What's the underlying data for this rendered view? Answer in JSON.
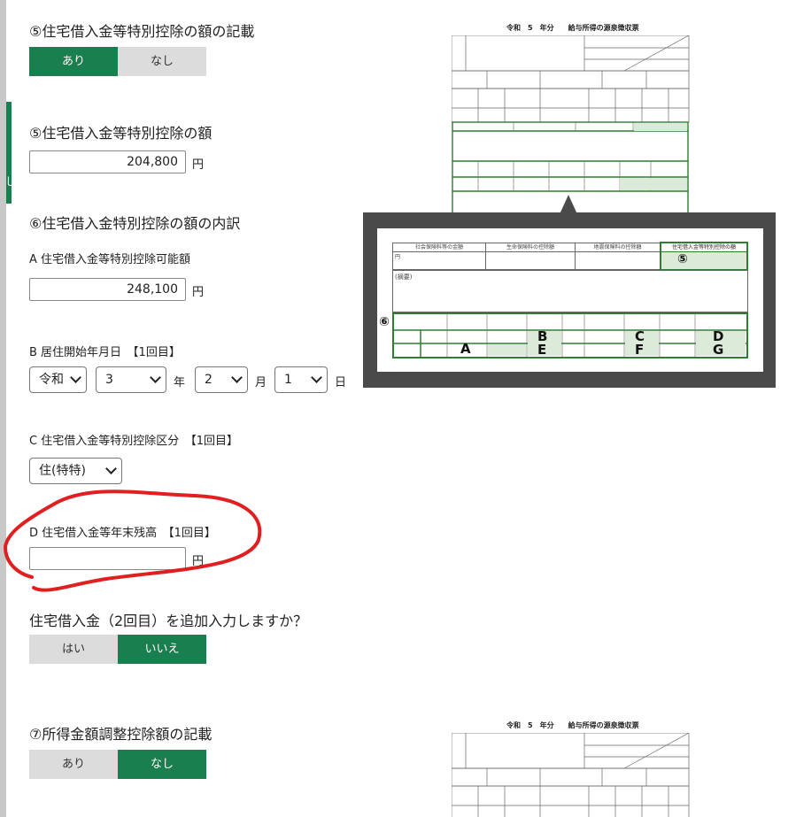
{
  "sidebar": {
    "accent_char": "し"
  },
  "section_5_flag": {
    "title": "⑤住宅借入金等特別控除の額の記載",
    "option_yes": "あり",
    "option_no": "なし",
    "selected": "あり"
  },
  "section_5_amount": {
    "title": "⑤住宅借入金等特別控除の額",
    "value": "204,800",
    "unit": "円"
  },
  "section_6": {
    "title": "⑥住宅借入金特別控除の額の内訳",
    "a_label": "A 住宅借入金等特別控除可能額",
    "a_value": "248,100",
    "a_unit": "円",
    "b_label": "B 居住開始年月日　【1回目】",
    "era": "令和",
    "year": "3",
    "year_unit": "年",
    "month": "2",
    "month_unit": "月",
    "day": "1",
    "day_unit": "日",
    "c_label": "C 住宅借入金等特別控除区分　【1回目】",
    "c_value": "住(特特)",
    "d_label": "D 住宅借入金等年末残高　【1回目】",
    "d_value": "",
    "d_unit": "円"
  },
  "second_loan": {
    "title": "住宅借入金（2回目）を追加入力しますか？",
    "option_yes": "はい",
    "option_no": "いいえ",
    "selected": "いいえ"
  },
  "section_7": {
    "title": "⑦所得金額調整控除額の記載",
    "option_yes": "あり",
    "option_no": "なし",
    "selected": "なし"
  },
  "withholding_slip": {
    "title": "令和　5　年分　　給与所得の源泉徴収票",
    "zoom": {
      "col1": "社会保険料等の金額",
      "col2": "生命保険料の控除額",
      "col3": "地震保険料の控除額",
      "col4": "住宅借入金等特別控除の額",
      "yen": "円",
      "tekiyo": "(摘要)",
      "marker_5": "⑤",
      "marker_6": "⑥",
      "letters": [
        "A",
        "B",
        "C",
        "D",
        "E",
        "F",
        "G"
      ]
    }
  },
  "colors": {
    "accent_green": "#1a7f4e",
    "annotation_red": "#e02020",
    "doc_green": "#2e7d32"
  }
}
